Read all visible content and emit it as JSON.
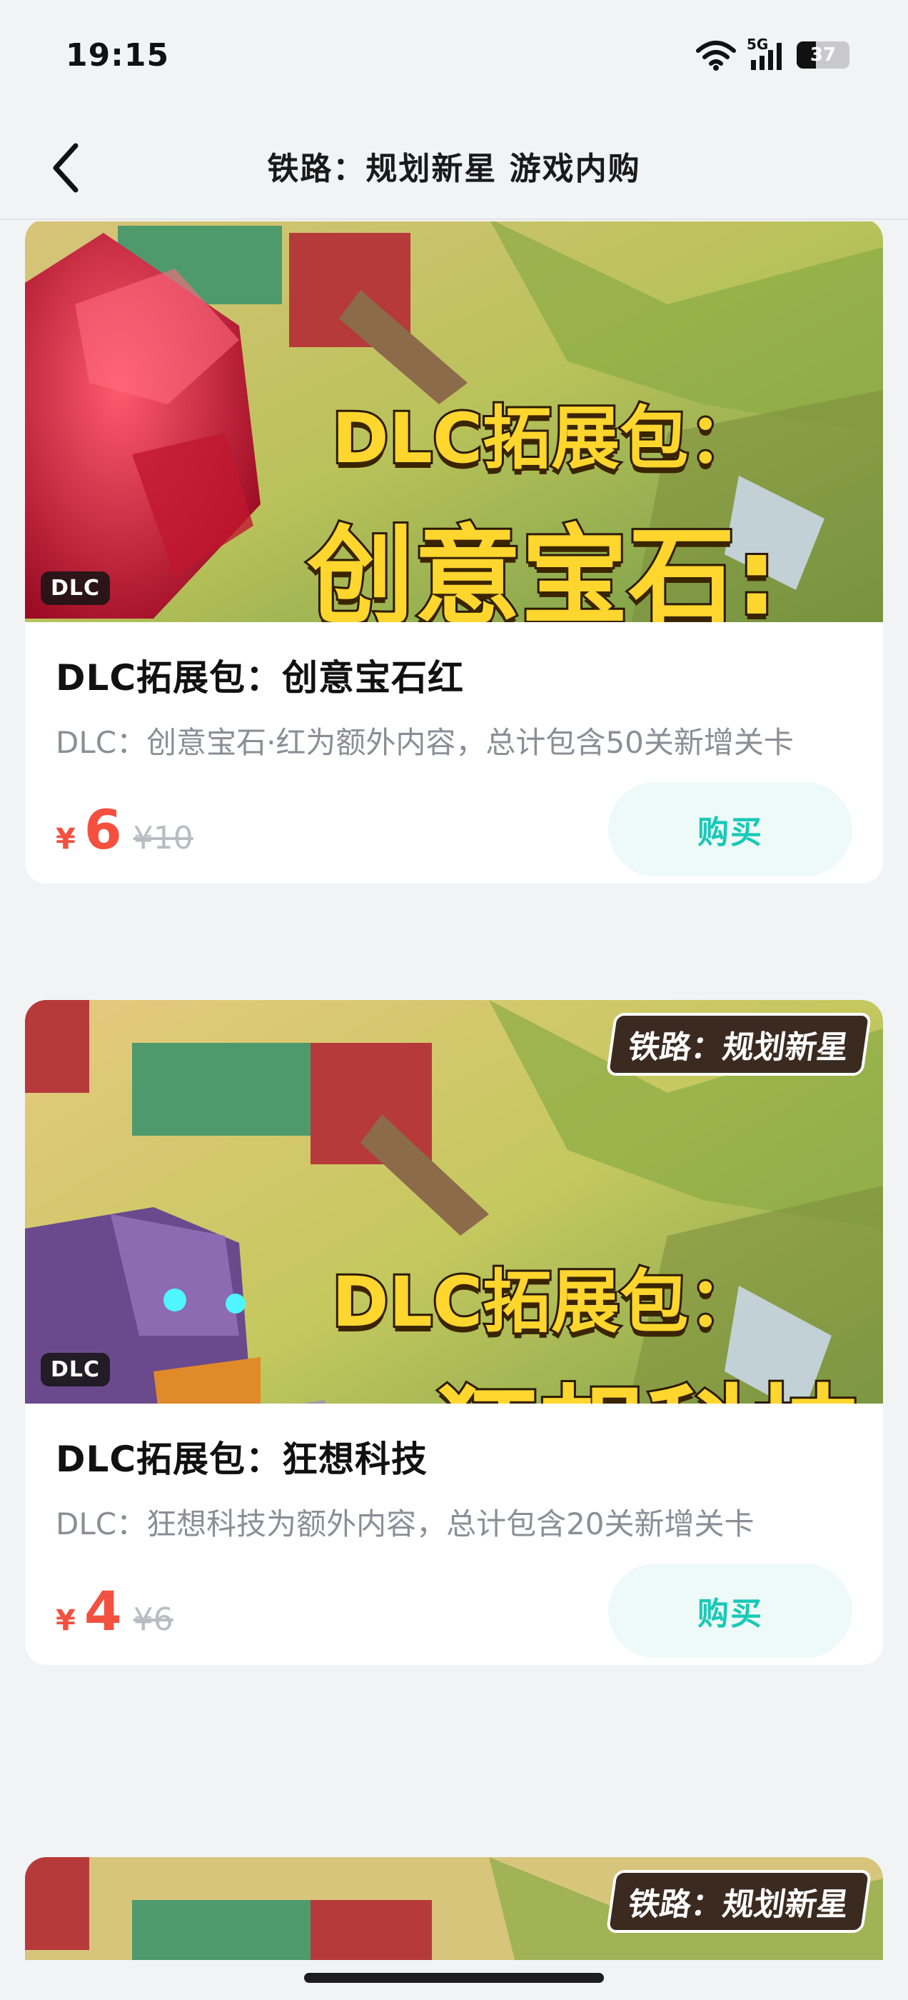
{
  "status_bar": {
    "time": "19:15",
    "network": "5G",
    "battery_level": "37"
  },
  "header": {
    "title": "铁路：规划新星 游戏内购",
    "back_icon": "chevron-left-icon"
  },
  "banner_logo": "铁路：规划新星",
  "badge_label": "DLC",
  "items": [
    {
      "banner_line1": "DLC拓展包：",
      "banner_line2": "创意宝石:红",
      "title": "DLC拓展包：创意宝石红",
      "description": "DLC：创意宝石·红为额外内容，总计包含50关新增关卡",
      "currency": "¥",
      "price": "6",
      "original_price": "¥10",
      "buy_label": "购买"
    },
    {
      "banner_line1": "DLC拓展包：",
      "banner_line2": "狂想科技",
      "title": "DLC拓展包：狂想科技",
      "description": "DLC：狂想科技为额外内容，总计包含20关新增关卡",
      "currency": "¥",
      "price": "4",
      "original_price": "¥6",
      "buy_label": "购买"
    }
  ],
  "colors": {
    "accent": "#19c9b7",
    "price": "#f4503f",
    "banner_text": "#ffd62e"
  }
}
